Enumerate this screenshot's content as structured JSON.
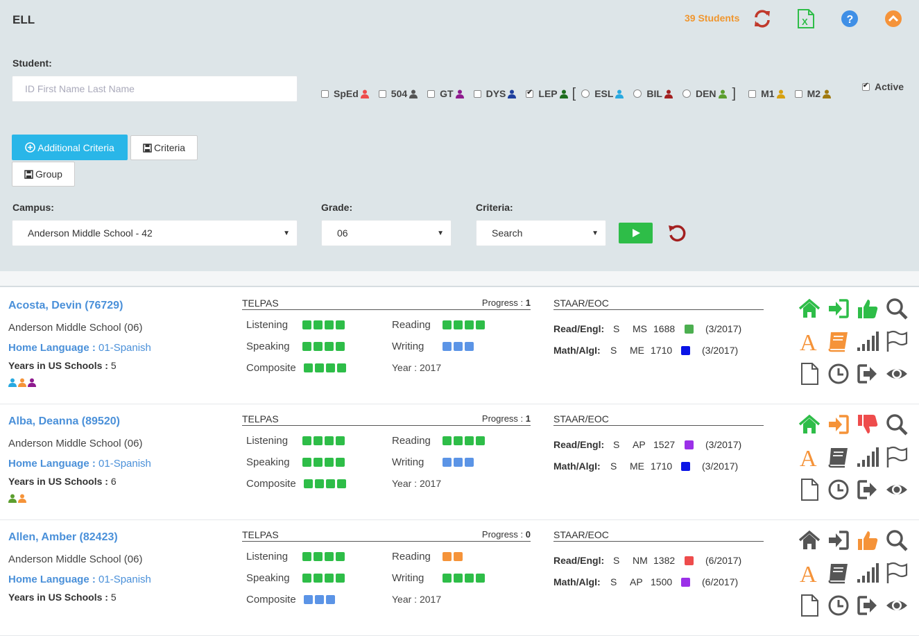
{
  "header": {
    "title": "ELL",
    "student_count": "39 Students"
  },
  "student": {
    "label": "Student:",
    "placeholder": "ID First Name Last Name"
  },
  "flags": {
    "sped": "SpEd",
    "f504": "504",
    "gt": "GT",
    "dys": "DYS",
    "lep": "LEP",
    "esl": "ESL",
    "bil": "BIL",
    "den": "DEN",
    "m1": "M1",
    "m2": "M2",
    "bracket_open": "[",
    "bracket_close": "]",
    "active": "Active"
  },
  "buttons": {
    "additional": "Additional Criteria",
    "criteria": "Criteria",
    "group": "Group"
  },
  "filters": {
    "campus_label": "Campus:",
    "campus_value": "Anderson Middle School - 42",
    "grade_label": "Grade:",
    "grade_value": "06",
    "criteria_label": "Criteria:",
    "criteria_value": "Search"
  },
  "labels": {
    "telpas": "TELPAS",
    "progress": "Progress : ",
    "staar": "STAAR/EOC",
    "listening": "Listening",
    "speaking": "Speaking",
    "composite": "Composite",
    "reading": "Reading",
    "writing": "Writing",
    "year": "Year : ",
    "read_engl": "Read/Engl:",
    "math_algi": "Math/AlgI:",
    "home_language": "Home Language : ",
    "years_us": "Years in US Schools : "
  },
  "colors": {
    "green": "#2ebd48",
    "blue": "#5b94e6",
    "orange": "#f59339",
    "accent": "#29b6e8"
  },
  "students": [
    {
      "name": "Acosta, Devin (76729)",
      "campus": "Anderson Middle School (06)",
      "language": "01-Spanish",
      "years": "5",
      "progress": "1",
      "year": "2017",
      "listening": {
        "count": 4,
        "color": "green"
      },
      "speaking": {
        "count": 4,
        "color": "green"
      },
      "composite": {
        "count": 4,
        "color": "green"
      },
      "reading": {
        "count": 4,
        "color": "green"
      },
      "writing": {
        "count": 3,
        "color": "blue"
      },
      "read": {
        "s": "S",
        "level": "MS",
        "score": "1688",
        "color": "#4caf50",
        "date": "(3/2017)"
      },
      "math": {
        "s": "S",
        "level": "ME",
        "score": "1710",
        "color": "#0a14e6",
        "date": "(3/2017)"
      },
      "people": [
        "#29a9e0",
        "#f59339",
        "#8e1a8e"
      ],
      "home_color": "#2ebd48",
      "enter_color": "#2ebd48",
      "thumb": "up",
      "thumb_color": "#2ebd48",
      "book_color": "#f59339"
    },
    {
      "name": "Alba, Deanna (89520)",
      "campus": "Anderson Middle School (06)",
      "language": "01-Spanish",
      "years": "6",
      "progress": "1",
      "year": "2017",
      "listening": {
        "count": 4,
        "color": "green"
      },
      "speaking": {
        "count": 4,
        "color": "green"
      },
      "composite": {
        "count": 4,
        "color": "green"
      },
      "reading": {
        "count": 4,
        "color": "green"
      },
      "writing": {
        "count": 3,
        "color": "blue"
      },
      "read": {
        "s": "S",
        "level": "AP",
        "score": "1527",
        "color": "#9b30e8",
        "date": "(3/2017)"
      },
      "math": {
        "s": "S",
        "level": "ME",
        "score": "1710",
        "color": "#0a14e6",
        "date": "(3/2017)"
      },
      "people": [
        "#5c9e2e",
        "#f59339"
      ],
      "home_color": "#2ebd48",
      "enter_color": "#f59339",
      "thumb": "down",
      "thumb_color": "#ee4c4c",
      "book_color": "#555555"
    },
    {
      "name": "Allen, Amber (82423)",
      "campus": "Anderson Middle School (06)",
      "language": "01-Spanish",
      "years": "5",
      "progress": "0",
      "year": "2017",
      "listening": {
        "count": 4,
        "color": "green"
      },
      "speaking": {
        "count": 4,
        "color": "green"
      },
      "composite": {
        "count": 3,
        "color": "blue"
      },
      "reading": {
        "count": 2,
        "color": "orange"
      },
      "writing": {
        "count": 4,
        "color": "green"
      },
      "read": {
        "s": "S",
        "level": "NM",
        "score": "1382",
        "color": "#ee4c4c",
        "date": "(6/2017)"
      },
      "math": {
        "s": "S",
        "level": "AP",
        "score": "1500",
        "color": "#9b30e8",
        "date": "(6/2017)"
      },
      "people": [],
      "home_color": "#555555",
      "enter_color": "#555555",
      "thumb": "up",
      "thumb_color": "#f59339",
      "book_color": "#555555"
    }
  ]
}
